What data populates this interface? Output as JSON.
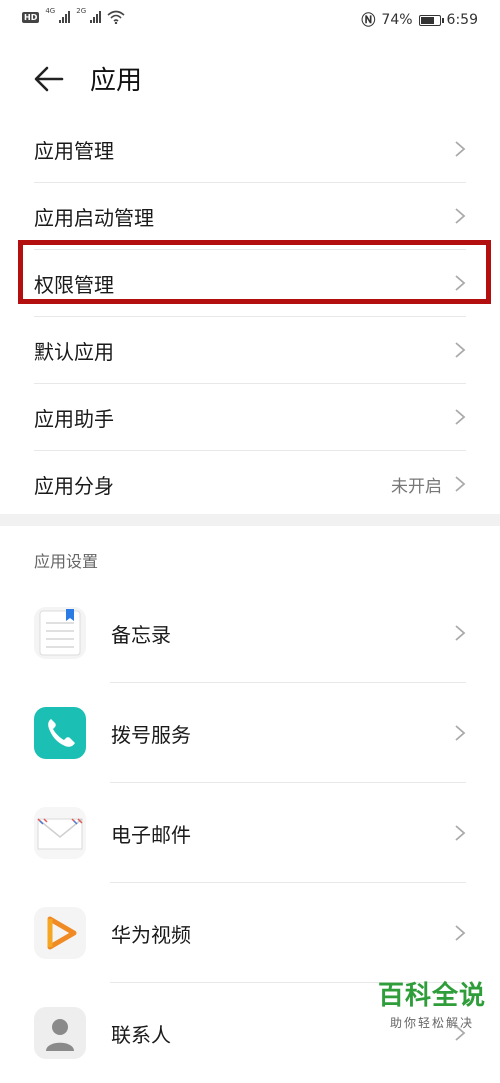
{
  "status_bar": {
    "hd": "HD",
    "sig1": "4G",
    "sig2": "2G",
    "battery_text": "74%",
    "battery_level": 0.74,
    "time": "6:59"
  },
  "header": {
    "title": "应用"
  },
  "menu": [
    {
      "label": "应用管理"
    },
    {
      "label": "应用启动管理"
    },
    {
      "label": "权限管理"
    },
    {
      "label": "默认应用"
    },
    {
      "label": "应用助手"
    },
    {
      "label": "应用分身",
      "value": "未开启"
    }
  ],
  "section": {
    "title": "应用设置"
  },
  "apps": [
    {
      "name": "备忘录",
      "icon": "notes-icon"
    },
    {
      "name": "拨号服务",
      "icon": "phone-icon"
    },
    {
      "name": "电子邮件",
      "icon": "mail-icon"
    },
    {
      "name": "华为视频",
      "icon": "video-icon"
    },
    {
      "name": "联系人",
      "icon": "contacts-icon"
    }
  ],
  "colors": {
    "highlight": "#b40f0f",
    "phone_icon_bg": "#1bbfb3",
    "video_icon_accent": "#f08a24",
    "watermark": "#2e9d3a"
  },
  "watermark": {
    "title": "百科全说",
    "subtitle": "助你轻松解决"
  }
}
